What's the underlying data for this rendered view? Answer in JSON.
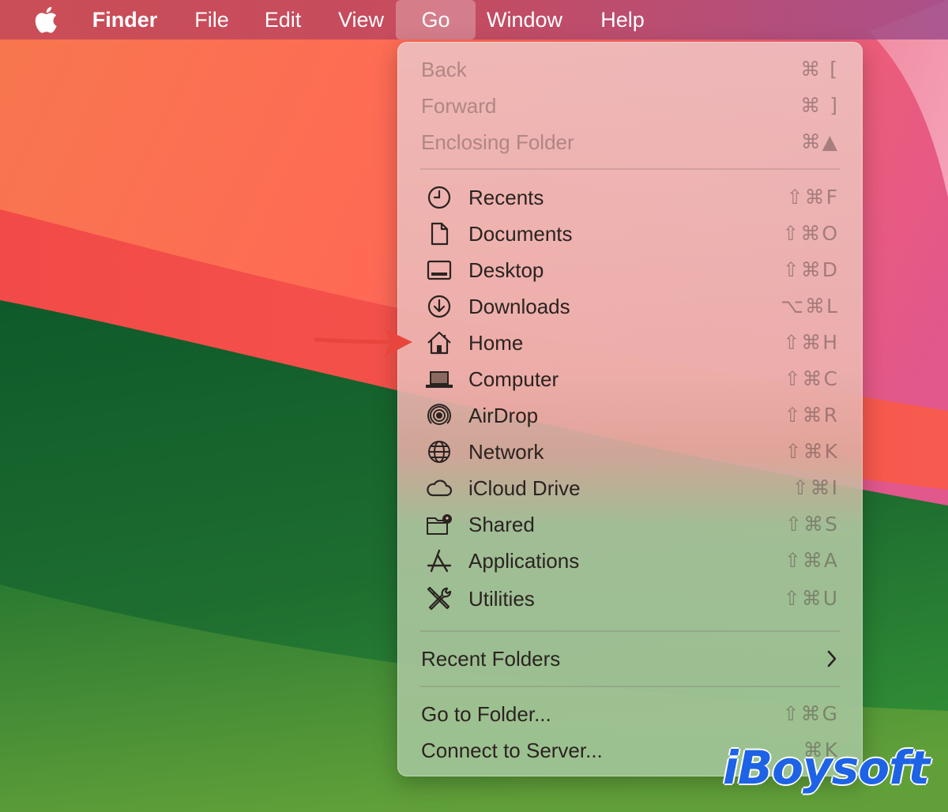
{
  "menubar": {
    "apple_icon": "apple-logo-icon",
    "items": [
      {
        "label": "Finder",
        "bold": true
      },
      {
        "label": "File"
      },
      {
        "label": "Edit"
      },
      {
        "label": "View"
      },
      {
        "label": "Go",
        "active": true
      },
      {
        "label": "Window"
      },
      {
        "label": "Help"
      }
    ]
  },
  "go_menu": {
    "nav": [
      {
        "label": "Back",
        "shortcut": "⌘ [",
        "disabled": true
      },
      {
        "label": "Forward",
        "shortcut": "⌘ ]",
        "disabled": true
      },
      {
        "label": "Enclosing Folder",
        "shortcut": "⌘▲",
        "disabled": true
      }
    ],
    "places": [
      {
        "label": "Recents",
        "shortcut": "⇧⌘F",
        "icon": "clock-icon"
      },
      {
        "label": "Documents",
        "shortcut": "⇧⌘O",
        "icon": "document-icon"
      },
      {
        "label": "Desktop",
        "shortcut": "⇧⌘D",
        "icon": "desktop-icon"
      },
      {
        "label": "Downloads",
        "shortcut": "⌥⌘L",
        "icon": "download-icon"
      },
      {
        "label": "Home",
        "shortcut": "⇧⌘H",
        "icon": "house-icon"
      },
      {
        "label": "Computer",
        "shortcut": "⇧⌘C",
        "icon": "laptop-icon"
      },
      {
        "label": "AirDrop",
        "shortcut": "⇧⌘R",
        "icon": "airdrop-icon"
      },
      {
        "label": "Network",
        "shortcut": "⇧⌘K",
        "icon": "globe-icon"
      },
      {
        "label": "iCloud Drive",
        "shortcut": "⇧⌘I",
        "icon": "cloud-icon"
      },
      {
        "label": "Shared",
        "shortcut": "⇧⌘S",
        "icon": "shared-folder-icon"
      },
      {
        "label": "Applications",
        "shortcut": "⇧⌘A",
        "icon": "app-store-icon"
      },
      {
        "label": "Utilities",
        "shortcut": "⇧⌘U",
        "icon": "tools-icon"
      }
    ],
    "recent_folders": {
      "label": "Recent Folders",
      "icon": "chevron-right-icon"
    },
    "bottom": [
      {
        "label": "Go to Folder...",
        "shortcut": "⇧⌘G"
      },
      {
        "label": "Connect to Server...",
        "shortcut": "⌘K"
      }
    ]
  },
  "annotation": {
    "icon": "pointer-arrow-icon",
    "points_to": "Home"
  },
  "watermark": {
    "text": "iBoysoft"
  },
  "colors": {
    "menu_text": "#2b2320",
    "disabled_text": "#a08a8a",
    "watermark": "#1e63e6",
    "arrow": "#e8463c"
  }
}
